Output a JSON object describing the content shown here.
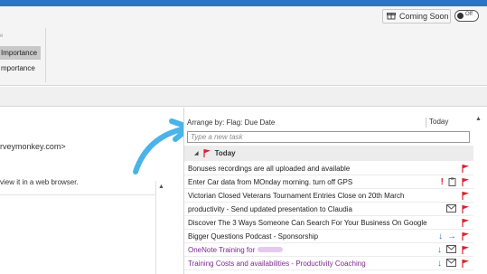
{
  "ribbon": {
    "high_importance": "Importance",
    "low_importance": "mportance",
    "coming_soon": "Coming Soon",
    "toggle_label": "Off"
  },
  "reading": {
    "email_fragment": "rveymonkey.com>",
    "browser_message": "view it in a web browser."
  },
  "todo": {
    "arrange_label": "Arrange by: Flag: Due Date",
    "column_today": "Today",
    "new_task_placeholder": "Type a new task",
    "group_label": "Today",
    "tasks": [
      {
        "title": "Bonuses recordings are all uploaded and available",
        "icons": [
          "flag"
        ]
      },
      {
        "title": "Enter Car data from MOnday morning. turn off GPS",
        "icons": [
          "exclamation",
          "clipboard",
          "flag"
        ]
      },
      {
        "title": "Victorian Closed Veterans Tournament Entries Close on 20th March",
        "icons": [
          "flag"
        ]
      },
      {
        "title": "productivity - Send updated presentation to Claudia",
        "icons": [
          "envelope",
          "flag"
        ]
      },
      {
        "title": "Discover The 3 Ways Someone Can Search For Your Business On Google",
        "icons": [
          "flag"
        ]
      },
      {
        "title": "Bigger Questions Podcast - Sponsorship",
        "icons": [
          "arrow-down",
          "arrow-right",
          "flag"
        ]
      },
      {
        "title": "OneNote Training for",
        "icons": [
          "arrow-down",
          "envelope",
          "flag"
        ]
      },
      {
        "title": "Training Costs and availabilities - Productivity Coaching",
        "icons": [
          "arrow-down",
          "envelope",
          "flag"
        ]
      }
    ]
  },
  "colors": {
    "accent": "#2b74c8",
    "flag_red": "#d9232e",
    "hand_arrow": "#4ab3e8",
    "link_purple": "#7b2a8c"
  }
}
